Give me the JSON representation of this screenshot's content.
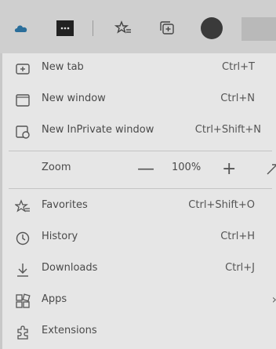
{
  "menu": {
    "new_tab": {
      "label": "New tab",
      "shortcut": "Ctrl+T",
      "icon": "new-tab-icon"
    },
    "new_window": {
      "label": "New window",
      "shortcut": "Ctrl+N",
      "icon": "window-icon"
    },
    "new_private": {
      "label": "New InPrivate window",
      "shortcut": "Ctrl+Shift+N",
      "icon": "inprivate-icon"
    },
    "zoom": {
      "label": "Zoom",
      "value": "100%",
      "minus": "—",
      "plus": "+"
    },
    "favorites": {
      "label": "Favorites",
      "shortcut": "Ctrl+Shift+O",
      "icon": "favorites-icon"
    },
    "history": {
      "label": "History",
      "shortcut": "Ctrl+H",
      "icon": "history-icon"
    },
    "downloads": {
      "label": "Downloads",
      "shortcut": "Ctrl+J",
      "icon": "download-icon"
    },
    "apps": {
      "label": "Apps",
      "icon": "apps-icon"
    },
    "extensions": {
      "label": "Extensions",
      "icon": "extensions-icon"
    }
  },
  "toolbar_icons": [
    "cloud-icon",
    "extension-puzzle-icon",
    "favorites-bar-icon",
    "collections-icon",
    "profile-avatar",
    "more-icon"
  ]
}
